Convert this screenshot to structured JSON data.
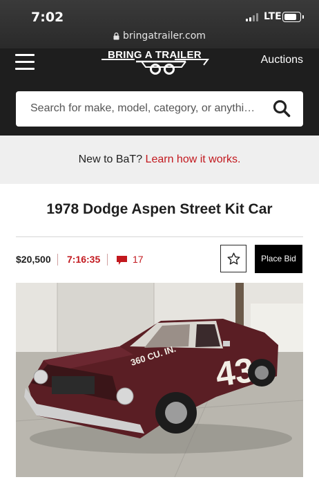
{
  "status_bar": {
    "time": "7:02",
    "network": "LTE",
    "url": "bringatrailer.com"
  },
  "nav": {
    "logo_text": "BRING A TRAILER",
    "auctions_label": "Auctions"
  },
  "search": {
    "placeholder": "Search for make, model, category, or anythi…"
  },
  "banner": {
    "text": "New to BaT?",
    "link": "Learn how it works."
  },
  "listing": {
    "title": "1978 Dodge Aspen Street Kit Car",
    "price": "$20,500",
    "time_left": "7:16:35",
    "comment_count": "17",
    "bid_label": "Place Bid"
  },
  "photo": {
    "car_number": "43",
    "hood_text": "360 CU. IN.",
    "car_color": "#5a1e24",
    "wall_color": "#e6e4df",
    "ground_color": "#b9b6ae"
  },
  "colors": {
    "accent": "#c2181e",
    "nav_bg": "#1e1e1e",
    "banner_bg": "#efefef"
  }
}
